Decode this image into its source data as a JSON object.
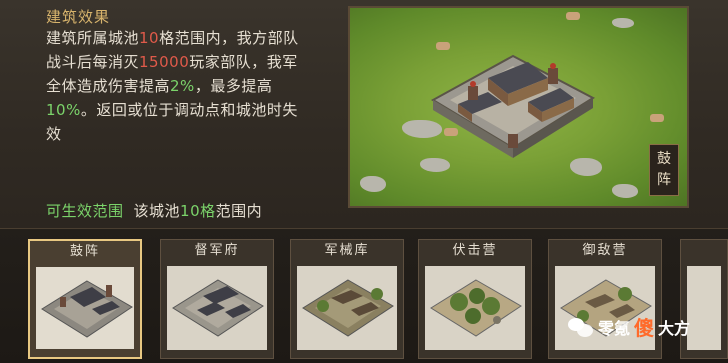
{
  "effect": {
    "title": "建筑效果",
    "line1_a": "建筑所属城池",
    "line1_num": "10",
    "line1_b": "格范围内，我方部队",
    "line2_a": "战斗后每消灭",
    "line2_num": "15000",
    "line2_b": "玩家部队，我军",
    "line3_a": "全体造成伤害提高",
    "line3_pct": "2%",
    "line3_b": "，最多提高",
    "line4_pct": "10%",
    "line4_b": "。返回或位于调动点和城池时失",
    "line5": "效"
  },
  "range": {
    "label": "可生效范围",
    "text_a": "该城池",
    "num": "10格",
    "text_b": "范围内"
  },
  "preview": {
    "badge_line1": "鼓",
    "badge_line2": "阵"
  },
  "buildings": [
    {
      "name": "鼓阵",
      "selected": true
    },
    {
      "name": "督军府",
      "selected": false
    },
    {
      "name": "军械库",
      "selected": false
    },
    {
      "name": "伏击营",
      "selected": false
    },
    {
      "name": "御敌营",
      "selected": false
    }
  ],
  "watermark": {
    "text_a": "零氪",
    "text_big": "傻",
    "text_b": "大方"
  },
  "colors": {
    "highlight_red": "#e05a4a",
    "highlight_green": "#7bd36a",
    "title_gold": "#d8b46c",
    "selected_border": "#e8c882"
  }
}
